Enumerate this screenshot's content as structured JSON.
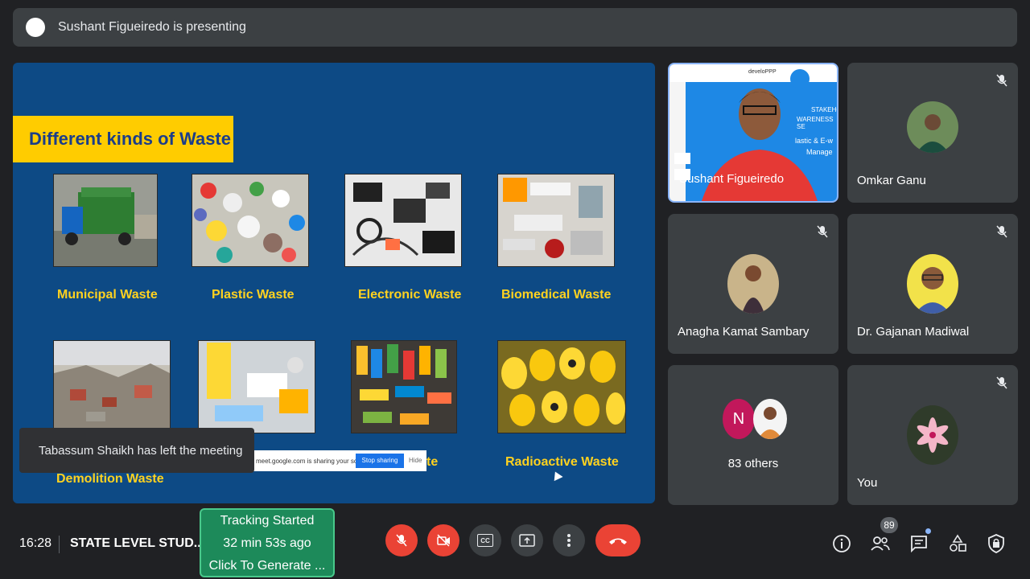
{
  "presenter_banner": {
    "text": "Sushant Figueiredo is presenting"
  },
  "slide": {
    "title": "Different kinds of Waste",
    "labels": {
      "municipal": "Municipal Waste",
      "plastic": "Plastic Waste",
      "electronic": "Electronic Waste",
      "biomedical": "Biomedical Waste",
      "demolition": "Demolition Waste",
      "hazardous_partial": "te",
      "radioactive": "Radioactive Waste"
    },
    "share_strip": {
      "text": "meet.google.com is sharing your screen.",
      "stop_label": "Stop sharing",
      "hide_label": "Hide"
    }
  },
  "toast": {
    "text": "Tabassum Shaikh has left the meeting"
  },
  "participants": {
    "speaker": {
      "name": "Sushant Figueiredo",
      "slide_fragments": [
        "develoPPP",
        "STAKEHO",
        "WARENESS SE",
        "lastic & E-w",
        "Manage"
      ]
    },
    "omkar": {
      "name": "Omkar Ganu"
    },
    "anagha": {
      "name": "Anagha Kamat Sambary"
    },
    "gajanan": {
      "name": "Dr. Gajanan Madiwal"
    },
    "others": {
      "initial": "N",
      "label": "83 others"
    },
    "you": {
      "name": "You"
    }
  },
  "bottom_bar": {
    "time": "16:28",
    "meeting_name": "STATE LEVEL STUD...",
    "tracking": {
      "line1": "Tracking Started",
      "line2": "32 min 53s ago",
      "line3": "Click To Generate ..."
    },
    "people_count": "89",
    "cc_label": "CC"
  },
  "colors": {
    "accent_red": "#ea4335",
    "slide_bg": "#0d4a85",
    "title_bar": "#ffcc00",
    "label_yellow": "#ffd21f",
    "tracking_green": "#1d8a5a"
  }
}
